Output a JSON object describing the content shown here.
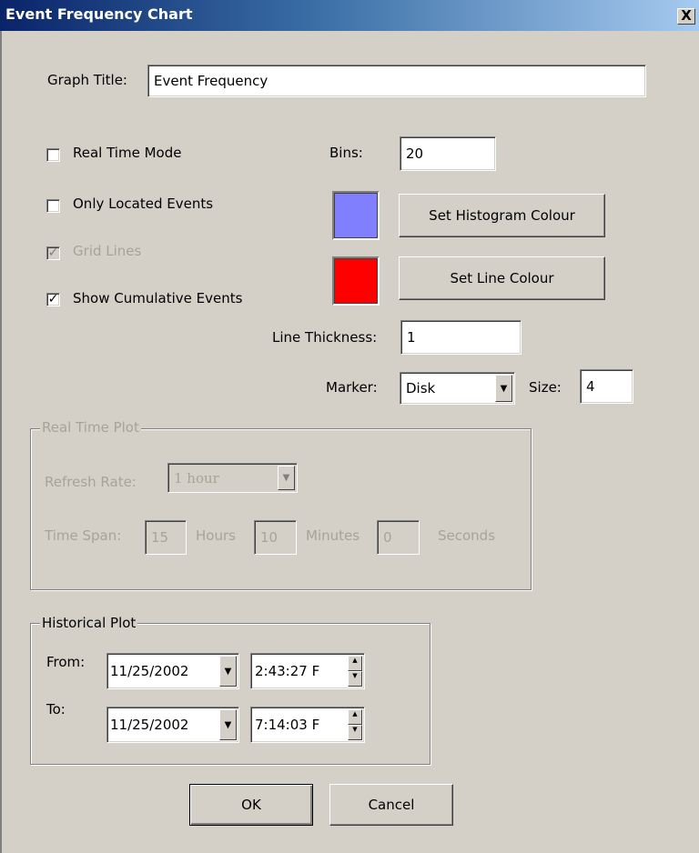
{
  "window": {
    "title": "Event Frequency Chart",
    "close_glyph": "X"
  },
  "graph_title": {
    "label": "Graph Title:",
    "value": "Event Frequency"
  },
  "options": {
    "real_time_mode": {
      "label": "Real Time Mode",
      "checked": false
    },
    "only_located_events": {
      "label": "Only Located Events",
      "checked": false
    },
    "grid_lines": {
      "label": "Grid Lines",
      "checked": true,
      "disabled": true
    },
    "show_cumulative_events": {
      "label": "Show Cumulative Events",
      "checked": true
    }
  },
  "bins": {
    "label": "Bins:",
    "value": "20"
  },
  "histogram_colour": {
    "swatch": "#8080ff",
    "button": "Set Histogram Colour"
  },
  "line_colour": {
    "swatch": "#ff0000",
    "button": "Set Line Colour"
  },
  "line_thickness": {
    "label": "Line Thickness:",
    "value": "1"
  },
  "marker": {
    "label": "Marker:",
    "value": "Disk",
    "size_label": "Size:",
    "size_value": "4"
  },
  "real_time_plot": {
    "legend": "Real Time Plot",
    "refresh_label": "Refresh Rate:",
    "refresh_value": "1 hour",
    "time_span_label": "Time Span:",
    "hours_value": "15",
    "hours_label": "Hours",
    "minutes_value": "10",
    "minutes_label": "Minutes",
    "seconds_value": "0",
    "seconds_label": "Seconds"
  },
  "historical_plot": {
    "legend": "Historical Plot",
    "from_label": "From:",
    "from_date": "11/25/2002",
    "from_time": "2:43:27 F",
    "to_label": "To:",
    "to_date": "11/25/2002",
    "to_time": "7:14:03 F"
  },
  "buttons": {
    "ok": "OK",
    "cancel": "Cancel"
  }
}
